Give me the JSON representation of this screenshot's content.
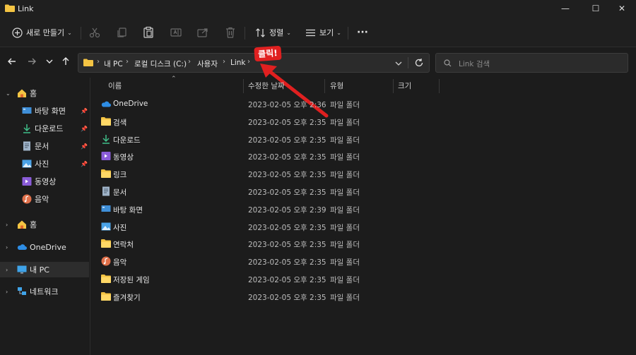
{
  "window": {
    "title": "Link",
    "minimize": "—",
    "maximize": "☐",
    "close": "✕"
  },
  "toolbar": {
    "new_label": "새로 만들기",
    "sort_label": "정렬",
    "view_label": "보기",
    "more_label": "···"
  },
  "address": {
    "crumbs": [
      "내 PC",
      "로컬 디스크 (C:)",
      "사용자",
      "Link"
    ],
    "search_placeholder": "Link 검색"
  },
  "sidebar": {
    "items": [
      {
        "label": "홈",
        "icon": "home-icon"
      },
      {
        "label": "바탕 화면",
        "icon": "desktop-icon",
        "pinned": true
      },
      {
        "label": "다운로드",
        "icon": "download-icon",
        "pinned": true
      },
      {
        "label": "문서",
        "icon": "document-icon",
        "pinned": true
      },
      {
        "label": "사진",
        "icon": "picture-icon",
        "pinned": true
      },
      {
        "label": "동영상",
        "icon": "video-icon"
      },
      {
        "label": "음악",
        "icon": "music-icon"
      },
      {
        "label": "홈",
        "icon": "home-icon"
      },
      {
        "label": "OneDrive",
        "icon": "cloud-icon"
      },
      {
        "label": "내 PC",
        "icon": "pc-icon",
        "selected": true
      },
      {
        "label": "네트워크",
        "icon": "network-icon"
      }
    ]
  },
  "columns": {
    "name": "이름",
    "date": "수정한 날짜",
    "type": "유형",
    "size": "크기"
  },
  "files": [
    {
      "name": "OneDrive",
      "date": "2023-02-05 오후 2:36",
      "type": "파일 폴더",
      "icon": "cloud-icon"
    },
    {
      "name": "검색",
      "date": "2023-02-05 오후 2:35",
      "type": "파일 폴더",
      "icon": "folder-icon"
    },
    {
      "name": "다운로드",
      "date": "2023-02-05 오후 2:35",
      "type": "파일 폴더",
      "icon": "download-icon"
    },
    {
      "name": "동영상",
      "date": "2023-02-05 오후 2:35",
      "type": "파일 폴더",
      "icon": "video-icon"
    },
    {
      "name": "링크",
      "date": "2023-02-05 오후 2:35",
      "type": "파일 폴더",
      "icon": "folder-icon"
    },
    {
      "name": "문서",
      "date": "2023-02-05 오후 2:35",
      "type": "파일 폴더",
      "icon": "document-icon"
    },
    {
      "name": "바탕 화면",
      "date": "2023-02-05 오후 2:39",
      "type": "파일 폴더",
      "icon": "desktop-icon"
    },
    {
      "name": "사진",
      "date": "2023-02-05 오후 2:35",
      "type": "파일 폴더",
      "icon": "picture-icon"
    },
    {
      "name": "연락처",
      "date": "2023-02-05 오후 2:35",
      "type": "파일 폴더",
      "icon": "folder-icon"
    },
    {
      "name": "음악",
      "date": "2023-02-05 오후 2:35",
      "type": "파일 폴더",
      "icon": "music-icon"
    },
    {
      "name": "저장된 게임",
      "date": "2023-02-05 오후 2:35",
      "type": "파일 폴더",
      "icon": "folder-icon"
    },
    {
      "name": "즐겨찾기",
      "date": "2023-02-05 오후 2:35",
      "type": "파일 폴더",
      "icon": "folder-icon"
    }
  ],
  "annotation": {
    "label": "클릭!",
    "color": "#e02020"
  },
  "colors": {
    "background": "#1c1c1c",
    "folder": "#f4c443",
    "accent": "#e02020"
  }
}
